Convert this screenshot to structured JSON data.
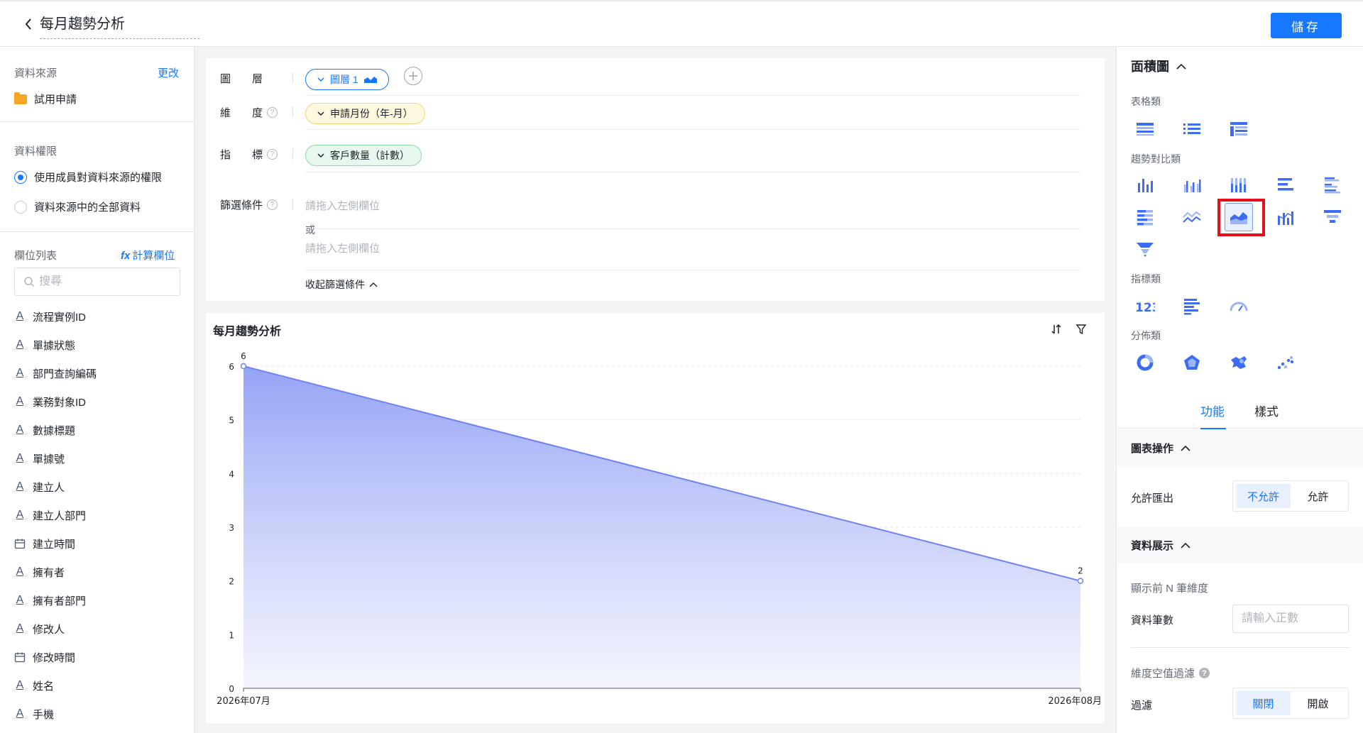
{
  "header": {
    "title": "每月趨勢分析",
    "save_label": "儲存"
  },
  "left": {
    "source_label": "資料來源",
    "change_link": "更改",
    "source_name": "試用申請",
    "permission_label": "資料權限",
    "permission_options": [
      "使用成員對資料來源的權限",
      "資料來源中的全部資料"
    ],
    "fields_label": "欄位列表",
    "calc_fx": "fx",
    "calc_link": "計算欄位",
    "search_placeholder": "搜尋",
    "fields": [
      {
        "name": "流程實例ID",
        "type": "text"
      },
      {
        "name": "單據狀態",
        "type": "text"
      },
      {
        "name": "部門查詢編碼",
        "type": "text"
      },
      {
        "name": "業務對象ID",
        "type": "text"
      },
      {
        "name": "數據標題",
        "type": "text"
      },
      {
        "name": "單據號",
        "type": "text"
      },
      {
        "name": "建立人",
        "type": "text"
      },
      {
        "name": "建立人部門",
        "type": "text"
      },
      {
        "name": "建立時間",
        "type": "date"
      },
      {
        "name": "擁有者",
        "type": "text"
      },
      {
        "name": "擁有者部門",
        "type": "text"
      },
      {
        "name": "修改人",
        "type": "text"
      },
      {
        "name": "修改時間",
        "type": "date"
      },
      {
        "name": "姓名",
        "type": "text"
      },
      {
        "name": "手機",
        "type": "text"
      }
    ]
  },
  "config": {
    "layer_label": "圖　　層",
    "layer_pill": "圖層 1",
    "dimension_label": "維　　度",
    "dimension_pill": "申請月份（年-月）",
    "metric_label": "指　　標",
    "metric_pill": "客戶數量（計數）",
    "filter_label": "篩選條件",
    "filter_placeholder": "請拖入左側欄位",
    "or_label": "或",
    "collapse_label": "收起篩選條件"
  },
  "chart_title": "每月趨勢分析",
  "chart_data": {
    "type": "area",
    "categories": [
      "2026年07月",
      "2026年08月"
    ],
    "values": [
      6,
      2
    ],
    "data_labels": [
      "6",
      "2"
    ],
    "ylim": [
      0,
      6
    ],
    "yticks": [
      0,
      1,
      2,
      3,
      4,
      5,
      6
    ],
    "grid": true,
    "color": "#7082f2"
  },
  "right": {
    "chart_type_title": "面積圖",
    "categories": [
      "表格類",
      "趨勢對比類",
      "指標類",
      "分佈類"
    ],
    "tabs": [
      "功能",
      "樣式"
    ],
    "group_chart_ops": "圖表操作",
    "allow_export_label": "允許匯出",
    "export_options": [
      "不允許",
      "允許"
    ],
    "group_display": "資料展示",
    "top_n_label": "顯示前 N 筆維度",
    "record_count_label": "資料筆數",
    "record_count_placeholder": "請輸入正數",
    "null_filter_label": "維度空值過濾",
    "filter_label": "過濾",
    "filter_options": [
      "關閉",
      "開啟"
    ]
  },
  "colors": {
    "accent": "#1677ff",
    "highlight": "#e3101b"
  }
}
